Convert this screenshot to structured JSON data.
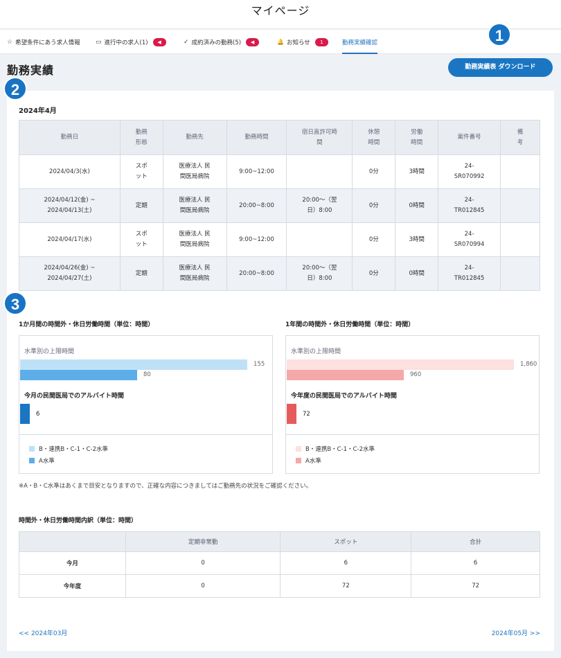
{
  "header": {
    "title": "マイページ"
  },
  "tabs": [
    {
      "icon": "☆",
      "icon_name": "star-icon",
      "label": "希望条件にあう求人情報"
    },
    {
      "icon": "▭",
      "icon_name": "message-icon",
      "label": "進行中の求人(1)",
      "badge": "◀"
    },
    {
      "icon": "✓",
      "icon_name": "check-icon",
      "label": "成約済みの勤務(5)",
      "badge": "◀"
    },
    {
      "icon": "🔔",
      "icon_name": "bell-icon",
      "label": "お知らせ",
      "badge": "1"
    },
    {
      "label": "勤務実績確認"
    }
  ],
  "page": {
    "title": "勤務実績",
    "download_label": "勤務実績表 ダウンロード"
  },
  "markers": [
    "1",
    "2",
    "3"
  ],
  "work_table": {
    "month": "2024年4月",
    "headers": [
      "勤務日",
      "勤務\n形態",
      "勤務先",
      "勤務時間",
      "宿日直許可時\n間",
      "休憩\n時間",
      "労働\n時間",
      "案件番号",
      "備\n考"
    ],
    "rows": [
      [
        "2024/04/3(水)",
        "スポ\nット",
        "医療法人 民\n間医局病院",
        "9:00~12:00",
        "",
        "0分",
        "3時間",
        "24-\nSR070992",
        ""
      ],
      [
        "2024/04/12(金) ~\n2024/04/13(土)",
        "定期",
        "医療法人 民\n間医局病院",
        "20:00~8:00",
        "20:00～（翌\n日）8:00",
        "0分",
        "0時間",
        "24-\nTR012845",
        ""
      ],
      [
        "2024/04/17(水)",
        "スポ\nット",
        "医療法人 民\n間医局病院",
        "9:00~12:00",
        "",
        "0分",
        "3時間",
        "24-\nSR070994",
        ""
      ],
      [
        "2024/04/26(金) ~\n2024/04/27(土)",
        "定期",
        "医療法人 民\n間医局病院",
        "20:00~8:00",
        "20:00～（翌\n日）8:00",
        "0分",
        "0時間",
        "24-\nTR012845",
        ""
      ]
    ]
  },
  "charts": {
    "monthly": {
      "title": "1か月間の時間外・休日労働時間（単位：時間）",
      "limit_label": "水準別の上限時間",
      "sub_label": "今月の民間医局でのアルバイト時間",
      "legend": [
        "B・連携B・C-1・C-2水準",
        "A水準"
      ],
      "colors": {
        "bc": "#bfe1f7",
        "a": "#5dade8",
        "actual": "#1a76c2"
      },
      "max": 155
    },
    "yearly": {
      "title": "1年間の時間外・休日労働時間（単位：時間）",
      "limit_label": "水準別の上限時間",
      "sub_label": "今年度の民間医局でのアルバイト時間",
      "legend": [
        "B・連携B・C-1・C-2水準",
        "A水準"
      ],
      "colors": {
        "bc": "#fde0e0",
        "a": "#f5a8a8",
        "actual": "#e55b5b"
      },
      "max": 1860
    }
  },
  "chart_data": [
    {
      "type": "bar",
      "title": "1か月間の時間外・休日労働時間（単位：時間）",
      "series": [
        {
          "name": "B・連携B・C-1・C-2水準",
          "values": [
            155
          ]
        },
        {
          "name": "A水準",
          "values": [
            80
          ]
        }
      ],
      "actual": {
        "label": "今月の民間医局でのアルバイト時間",
        "value": 6
      },
      "value_labels": [
        "155",
        "80",
        "6"
      ]
    },
    {
      "type": "bar",
      "title": "1年間の時間外・休日労働時間（単位：時間）",
      "series": [
        {
          "name": "B・連携B・C-1・C-2水準",
          "values": [
            1860
          ]
        },
        {
          "name": "A水準",
          "values": [
            960
          ]
        }
      ],
      "actual": {
        "label": "今年度の民間医局でのアルバイト時間",
        "value": 72
      },
      "value_labels": [
        "1,860",
        "960",
        "72"
      ]
    }
  ],
  "note": "※A・B・C水準はあくまで目安となりますので、正確な内容につきましてはご勤務先の状況をご確認ください。",
  "breakdown": {
    "title": "時間外・休日労働時間内訳（単位：時間）",
    "headers": [
      "",
      "定期非常勤",
      "スポット",
      "合計"
    ],
    "rows": [
      [
        "今月",
        "0",
        "6",
        "6"
      ],
      [
        "今年度",
        "0",
        "72",
        "72"
      ]
    ]
  },
  "pager": {
    "prev": "<< 2024年03月",
    "next": "2024年05月 >>"
  }
}
